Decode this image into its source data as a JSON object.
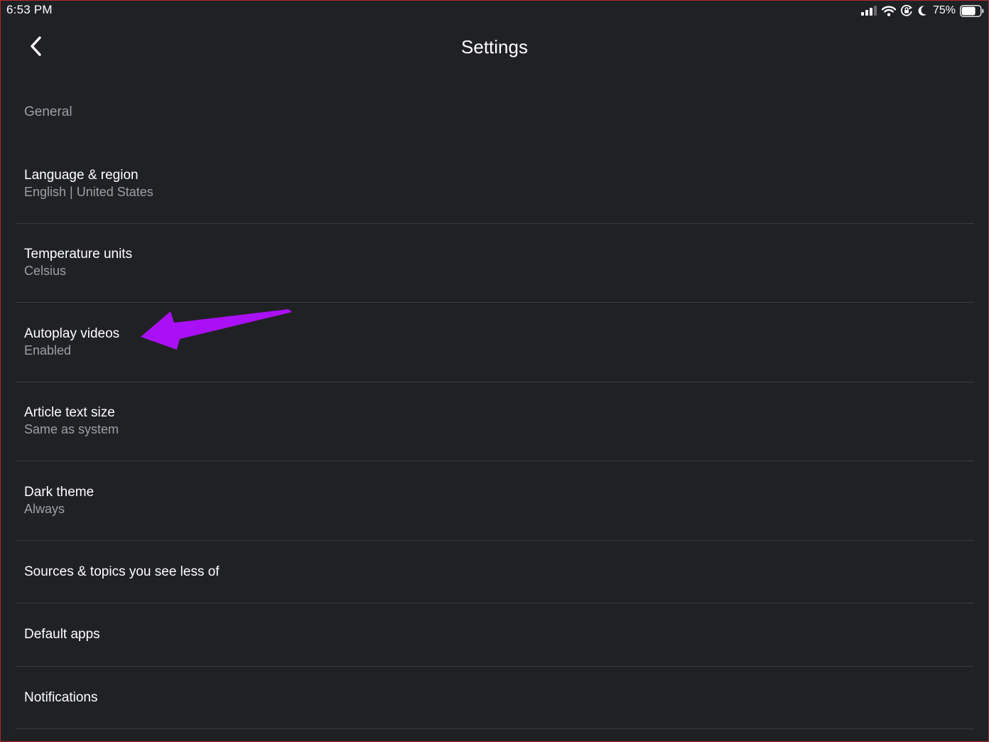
{
  "status_bar": {
    "time": "6:53 PM",
    "battery_percent": "75%",
    "battery_level": 0.75,
    "icons": [
      "cellular-signal-icon",
      "wifi-icon",
      "orientation-lock-icon",
      "do-not-disturb-moon-icon",
      "battery-icon"
    ]
  },
  "header": {
    "title": "Settings",
    "back_icon": "chevron-left-icon"
  },
  "settings": {
    "section_label": "General",
    "items": [
      {
        "title": "Language & region",
        "subtitle": "English | United States"
      },
      {
        "title": "Temperature units",
        "subtitle": "Celsius"
      },
      {
        "title": "Autoplay videos",
        "subtitle": "Enabled"
      },
      {
        "title": "Article text size",
        "subtitle": "Same as system"
      },
      {
        "title": "Dark theme",
        "subtitle": "Always"
      },
      {
        "title": "Sources & topics you see less of"
      },
      {
        "title": "Default apps"
      },
      {
        "title": "Notifications"
      }
    ]
  },
  "annotation": {
    "color": "#aa10f5",
    "points_to": "Autoplay videos"
  },
  "colors": {
    "background": "#202124",
    "primary_text": "#ffffff",
    "secondary_text": "#9aa0a6",
    "divider": "#3a3b3e"
  }
}
